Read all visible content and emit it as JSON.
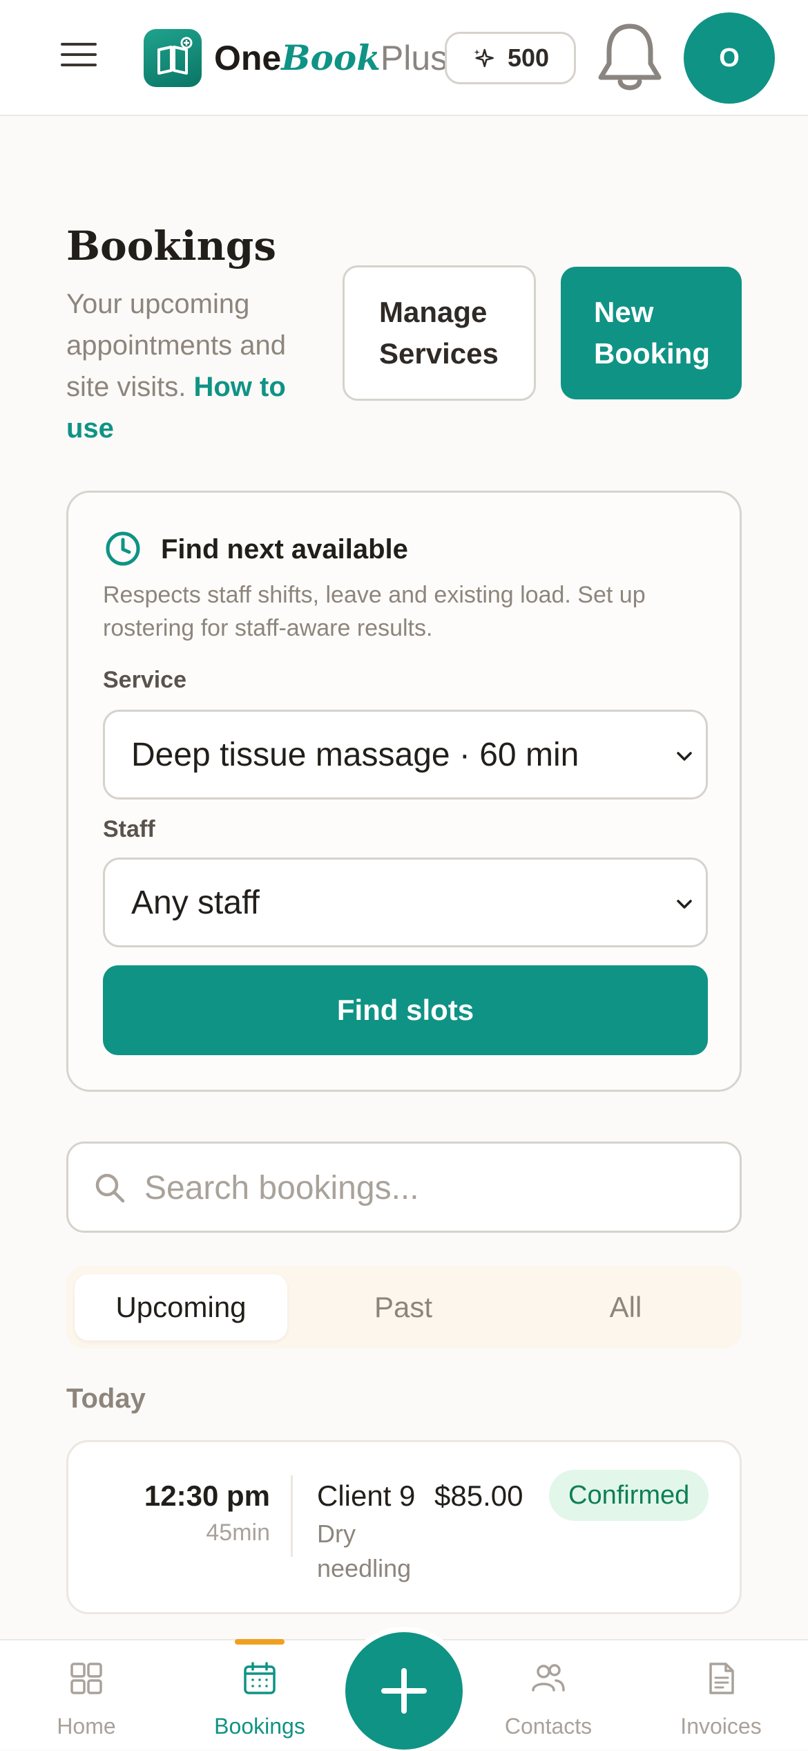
{
  "header": {
    "logo_one": "One",
    "logo_book": "Book",
    "logo_plus": "Plus",
    "credits": "500",
    "avatar_initial": "O"
  },
  "page": {
    "title": "Bookings",
    "subtitle": "Your upcoming appointments and site visits.",
    "how_to_link": "How to use",
    "manage_line1": "Manage",
    "manage_line2": "Services",
    "new_line1": "New",
    "new_line2": "Booking"
  },
  "finder": {
    "title": "Find next available",
    "description": "Respects staff shifts, leave and existing load. Set up rostering for staff-aware results.",
    "service_label": "Service",
    "service_value": "Deep tissue massage · 60 min",
    "staff_label": "Staff",
    "staff_value": "Any staff",
    "find_button": "Find slots"
  },
  "search": {
    "placeholder": "Search bookings..."
  },
  "tabs": [
    {
      "label": "Upcoming",
      "active": true
    },
    {
      "label": "Past",
      "active": false
    },
    {
      "label": "All",
      "active": false
    }
  ],
  "sections": {
    "today": "Today"
  },
  "bookings": [
    {
      "time": "12:30 pm",
      "duration": "45min",
      "client": "Client 9",
      "price": "$85.00",
      "service": "Dry needling",
      "status": "Confirmed"
    }
  ],
  "bottom_nav": [
    {
      "label": "Home",
      "icon": "grid-icon"
    },
    {
      "label": "Bookings",
      "icon": "calendar-icon",
      "active": true
    },
    {
      "label": "Contacts",
      "icon": "people-icon"
    },
    {
      "label": "Invoices",
      "icon": "document-icon"
    }
  ],
  "colors": {
    "brand": "#0f9385",
    "status_confirmed_bg": "#e2f6ea",
    "status_confirmed_text": "#0d7f55",
    "active_indicator": "#f0a020"
  }
}
